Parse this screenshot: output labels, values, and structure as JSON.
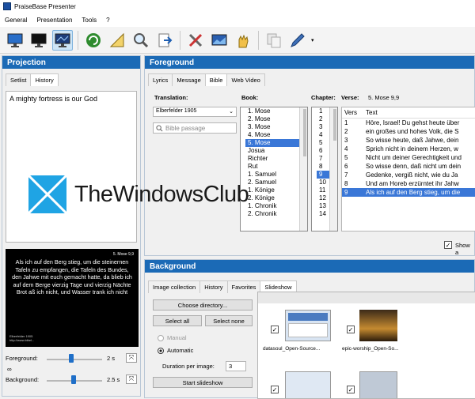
{
  "window": {
    "title": "PraiseBase Presenter"
  },
  "menu": [
    "General",
    "Presentation",
    "Tools",
    "?"
  ],
  "toolbar": {
    "icons": [
      "monitor-blue-icon",
      "monitor-black-icon",
      "monitor-live-icon",
      "refresh-icon",
      "ruler-pencil-icon",
      "search-icon",
      "export-icon",
      "tools-icon",
      "monitor-image-icon",
      "hand-icon",
      "copy-icon",
      "pen-icon"
    ]
  },
  "projection": {
    "header": "Projection",
    "tabs": [
      "Setlist",
      "History"
    ],
    "history_item": "A mighty fortress is our God",
    "preview": {
      "ref": "5. Mose 9,9",
      "text": "Als ich auf den Berg stieg, um die steinernen Tafeln zu empfangen, die Tafeln des Bundes, den Jahwe mit euch gemacht hatte, da blieb ich auf dem Berge vierzig Tage und vierzig Nächte Brot aß ich nicht, und Wasser trank ich nicht",
      "footer": "Elberfelder 1905\nhttp://www.bibel..."
    },
    "foreground_label": "Foreground:",
    "foreground_value": "2 s",
    "background_label": "Background:",
    "background_value": "2.5 s"
  },
  "foreground": {
    "header": "Foreground",
    "tabs": [
      "Lyrics",
      "Message",
      "Bible",
      "Web Video"
    ],
    "translation_label": "Translation:",
    "translation_value": "Elberfelder 1905",
    "search_placeholder": "Bible passage",
    "book_label": "Book:",
    "books": [
      "1. Mose",
      "2. Mose",
      "3. Mose",
      "4. Mose",
      "5. Mose",
      "Josua",
      "Richter",
      "Rut",
      "1. Samuel",
      "2. Samuel",
      "1. Könige",
      "2. Könige",
      "1. Chronik",
      "2. Chronik"
    ],
    "chapter_label": "Chapter:",
    "chapters": [
      "1",
      "2",
      "3",
      "4",
      "5",
      "6",
      "7",
      "8",
      "9",
      "10",
      "11",
      "12",
      "13",
      "14"
    ],
    "verse_label": "Verse:",
    "verse_ref": "5. Mose 9,9",
    "verse_headers": [
      "Vers",
      "Text"
    ],
    "verses": [
      {
        "n": "1",
        "t": "Höre, Israel! Du gehst heute über"
      },
      {
        "n": "2",
        "t": "ein großes und hohes Volk, die S"
      },
      {
        "n": "3",
        "t": "So wisse heute, daß Jahwe, dein"
      },
      {
        "n": "4",
        "t": "Sprich nicht in deinem Herzen, w"
      },
      {
        "n": "5",
        "t": "Nicht um deiner Gerechtigkeit und"
      },
      {
        "n": "6",
        "t": "So wisse denn, daß nicht um dein"
      },
      {
        "n": "7",
        "t": "Gedenke, vergiß nicht, wie du Ja"
      },
      {
        "n": "8",
        "t": "Und am Horeb erzürntet ihr Jahw"
      },
      {
        "n": "9",
        "t": "Als ich auf den Berg stieg, um die"
      }
    ],
    "show_label": "Show a"
  },
  "background": {
    "header": "Background",
    "tabs": [
      "Image collection",
      "History",
      "Favorites",
      "Slideshow"
    ],
    "choose_dir": "Choose directory...",
    "select_all": "Select all",
    "select_none": "Select none",
    "manual": "Manual",
    "automatic": "Automatic",
    "duration_label": "Duration per image:",
    "duration_value": "3",
    "start": "Start slideshow",
    "thumbs": [
      {
        "label": "datasoul_Open-Source..."
      },
      {
        "label": "epic-worship_Open-So..."
      }
    ]
  },
  "watermark": "TheWindowsClub",
  "colors": {
    "header_blue": "#1b6ab6",
    "select_blue": "#3a77d7"
  }
}
